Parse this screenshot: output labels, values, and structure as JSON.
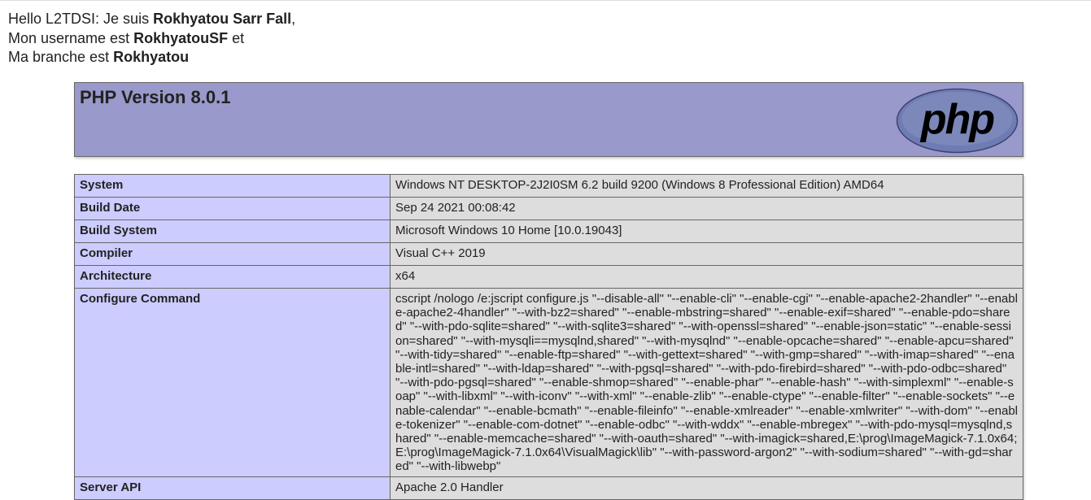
{
  "intro": {
    "line1_prefix": "Hello L2TDSI: Je suis ",
    "name": "Rokhyatou Sarr Fall",
    "line1_suffix": ",",
    "line2_prefix": "Mon username est ",
    "username": "RokhyatouSF",
    "line2_suffix": " et",
    "line3_prefix": "Ma branche est ",
    "branch": "Rokhyatou"
  },
  "header": {
    "title": "PHP Version 8.0.1",
    "logo_text": "php"
  },
  "colors": {
    "header_bg": "#9999cc",
    "label_bg": "#ccccff",
    "value_bg": "#dddddd"
  },
  "rows": [
    {
      "label": "System",
      "value": "Windows NT DESKTOP-2J2I0SM 6.2 build 9200 (Windows 8 Professional Edition) AMD64"
    },
    {
      "label": "Build Date",
      "value": "Sep 24 2021 00:08:42"
    },
    {
      "label": "Build System",
      "value": "Microsoft Windows 10 Home [10.0.19043]"
    },
    {
      "label": "Compiler",
      "value": "Visual C++ 2019"
    },
    {
      "label": "Architecture",
      "value": "x64"
    },
    {
      "label": "Configure Command",
      "value": "cscript /nologo /e:jscript configure.js \"--disable-all\" \"--enable-cli\" \"--enable-cgi\" \"--enable-apache2-2handler\" \"--enable-apache2-4handler\" \"--with-bz2=shared\" \"--enable-mbstring=shared\" \"--enable-exif=shared\" \"--enable-pdo=shared\" \"--with-pdo-sqlite=shared\" \"--with-sqlite3=shared\" \"--with-openssl=shared\" \"--enable-json=static\" \"--enable-session=shared\" \"--with-mysqli==mysqlnd,shared\" \"--with-mysqlnd\" \"--enable-opcache=shared\" \"--enable-apcu=shared\" \"--with-tidy=shared\" \"--enable-ftp=shared\" \"--with-gettext=shared\" \"--with-gmp=shared\" \"--with-imap=shared\" \"--enable-intl=shared\" \"--with-ldap=shared\" \"--with-pgsql=shared\" \"--with-pdo-firebird=shared\" \"--with-pdo-odbc=shared\" \"--with-pdo-pgsql=shared\" \"--enable-shmop=shared\" \"--enable-phar\" \"--enable-hash\" \"--with-simplexml\" \"--enable-soap\" \"--with-libxml\" \"--with-iconv\" \"--with-xml\" \"--enable-zlib\" \"--enable-ctype\" \"--enable-filter\" \"--enable-sockets\" \"--enable-calendar\" \"--enable-bcmath\" \"--enable-fileinfo\" \"--enable-xmlreader\" \"--enable-xmlwriter\" \"--with-dom\" \"--enable-tokenizer\" \"--enable-com-dotnet\" \"--enable-odbc\" \"--with-wddx\" \"--enable-mbregex\" \"--with-pdo-mysql=mysqlnd,shared\" \"--enable-memcache=shared\" \"--with-oauth=shared\" \"--with-imagick=shared,E:\\prog\\ImageMagick-7.1.0x64;E:\\prog\\ImageMagick-7.1.0x64\\VisualMagick\\lib\" \"--with-password-argon2\" \"--with-sodium=shared\" \"--with-gd=shared\" \"--with-libwebp\""
    },
    {
      "label": "Server API",
      "value": "Apache 2.0 Handler"
    }
  ]
}
